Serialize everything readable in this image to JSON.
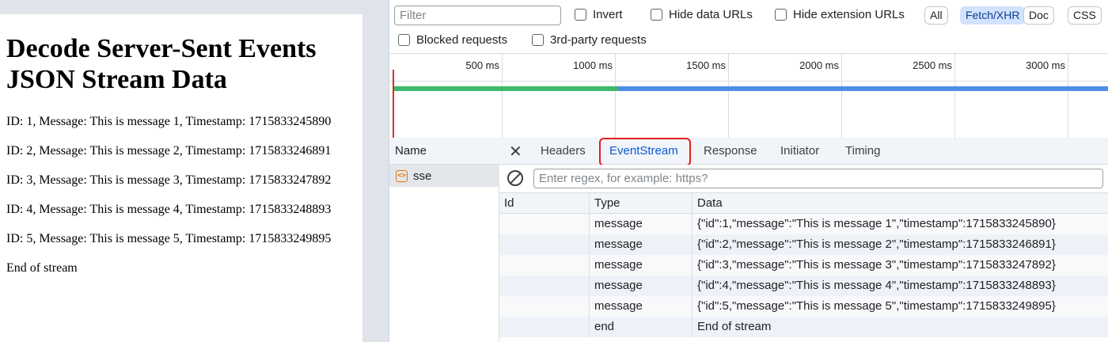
{
  "page": {
    "title": "Decode Server-Sent Events JSON Stream Data",
    "lines": [
      "ID: 1, Message: This is message 1, Timestamp: 1715833245890",
      "ID: 2, Message: This is message 2, Timestamp: 1715833246891",
      "ID: 3, Message: This is message 3, Timestamp: 1715833247892",
      "ID: 4, Message: This is message 4, Timestamp: 1715833248893",
      "ID: 5, Message: This is message 5, Timestamp: 1715833249895",
      "End of stream"
    ]
  },
  "toolbar": {
    "filter_placeholder": "Filter",
    "invert": "Invert",
    "hide_data_urls": "Hide data URLs",
    "hide_extension_urls": "Hide extension URLs",
    "chips": [
      "All",
      "Fetch/XHR",
      "Doc",
      "CSS"
    ],
    "active_chip": "Fetch/XHR",
    "blocked_requests": "Blocked requests",
    "third_party": "3rd-party requests"
  },
  "timeline": {
    "ticks": [
      "500 ms",
      "1000 ms",
      "1500 ms",
      "2000 ms",
      "2500 ms",
      "3000 ms"
    ]
  },
  "requests": {
    "header": "Name",
    "items": [
      {
        "name": "sse"
      }
    ]
  },
  "detail": {
    "tabs": [
      "Headers",
      "EventStream",
      "Response",
      "Initiator",
      "Timing"
    ],
    "active_tab": "EventStream",
    "regex_placeholder": "Enter regex, for example: https?",
    "columns": [
      "Id",
      "Type",
      "Data"
    ],
    "events": [
      {
        "id": "",
        "type": "message",
        "data": "{\"id\":1,\"message\":\"This is message 1\",\"timestamp\":1715833245890}"
      },
      {
        "id": "",
        "type": "message",
        "data": "{\"id\":2,\"message\":\"This is message 2\",\"timestamp\":1715833246891}"
      },
      {
        "id": "",
        "type": "message",
        "data": "{\"id\":3,\"message\":\"This is message 3\",\"timestamp\":1715833247892}"
      },
      {
        "id": "",
        "type": "message",
        "data": "{\"id\":4,\"message\":\"This is message 4\",\"timestamp\":1715833248893}"
      },
      {
        "id": "",
        "type": "message",
        "data": "{\"id\":5,\"message\":\"This is message 5\",\"timestamp\":1715833249895}"
      },
      {
        "id": "",
        "type": "end",
        "data": "End of stream"
      }
    ]
  }
}
